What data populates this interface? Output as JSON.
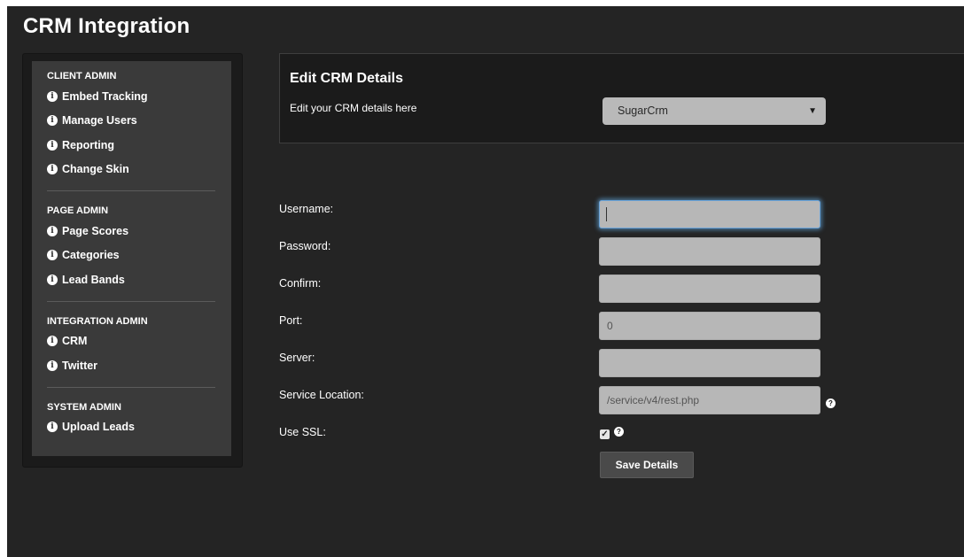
{
  "page": {
    "title": "CRM Integration"
  },
  "sidebar": {
    "sections": [
      {
        "title": "CLIENT ADMIN",
        "items": [
          "Embed Tracking",
          "Manage Users",
          "Reporting",
          "Change Skin"
        ]
      },
      {
        "title": "PAGE ADMIN",
        "items": [
          "Page Scores",
          "Categories",
          "Lead Bands"
        ]
      },
      {
        "title": "INTEGRATION ADMIN",
        "items": [
          "CRM",
          "Twitter"
        ]
      },
      {
        "title": "SYSTEM ADMIN",
        "items": [
          "Upload Leads"
        ]
      }
    ]
  },
  "crm_panel": {
    "title": "Edit CRM Details",
    "subtitle": "Edit your CRM details here",
    "crm_type": "SugarCrm"
  },
  "form": {
    "username_label": "Username:",
    "username_value": "",
    "password_label": "Password:",
    "confirm_label": "Confirm:",
    "port_label": "Port:",
    "port_value": "0",
    "server_label": "Server:",
    "service_location_label": "Service Location:",
    "service_location_value": "/service/v4/rest.php",
    "use_ssl_label": "Use SSL:",
    "use_ssl_checked": true,
    "save_label": "Save Details"
  },
  "colors": {
    "background": "#242424",
    "panel": "#1b1b1b",
    "sidebar_inner": "#3a3a3a",
    "input": "#b7b7b7",
    "focus_glow": "#66afe9"
  },
  "icons": {
    "nav": "info-icon",
    "help": "help-icon",
    "checkbox": "checkbox-icon"
  }
}
